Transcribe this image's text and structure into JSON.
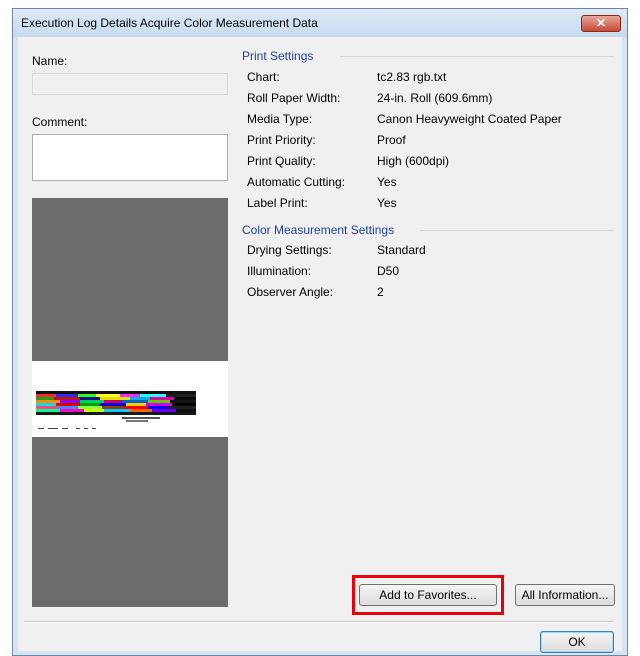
{
  "window": {
    "title": "Execution Log Details Acquire Color Measurement Data",
    "close_symbol": "✕"
  },
  "left": {
    "name_label": "Name:",
    "comment_label": "Comment:"
  },
  "print_settings": {
    "header": "Print Settings",
    "rows": [
      {
        "key": "Chart:",
        "value": "tc2.83 rgb.txt"
      },
      {
        "key": "Roll Paper Width:",
        "value": "24-in. Roll (609.6mm)"
      },
      {
        "key": "Media Type:",
        "value": "Canon Heavyweight Coated Paper"
      },
      {
        "key": "Print Priority:",
        "value": "Proof"
      },
      {
        "key": "Print Quality:",
        "value": "High (600dpi)"
      },
      {
        "key": "Automatic Cutting:",
        "value": "Yes"
      },
      {
        "key": "Label Print:",
        "value": "Yes"
      }
    ]
  },
  "color_settings": {
    "header": "Color Measurement Settings",
    "rows": [
      {
        "key": "Drying Settings:",
        "value": "Standard"
      },
      {
        "key": "Illumination:",
        "value": "D50"
      },
      {
        "key": "Observer Angle:",
        "value": "2"
      }
    ]
  },
  "buttons": {
    "add_favorites": "Add to Favorites...",
    "all_information": "All Information...",
    "ok": "OK"
  },
  "colors": {
    "section_header": "#1f3f9c",
    "highlight": "#e8000a",
    "preview_background": "#6c6c6c"
  }
}
